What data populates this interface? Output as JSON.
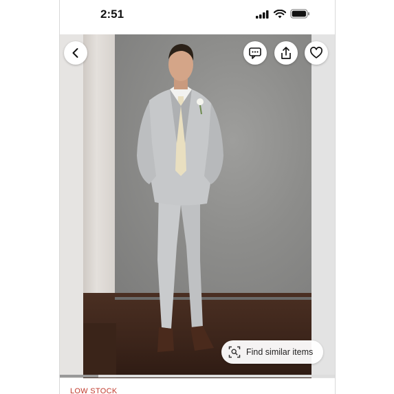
{
  "status_bar": {
    "time": "2:51",
    "icons": [
      "signal-icon",
      "wifi-icon",
      "battery-icon"
    ]
  },
  "photo": {
    "subject": "man-in-light-grey-suit",
    "carousel_position": 0.14
  },
  "overlay_buttons": {
    "back": "chevron-left-icon",
    "message": "message-icon",
    "share": "share-icon",
    "favorite": "heart-icon"
  },
  "find_similar": {
    "icon": "visual-search-icon",
    "label": "Find similar items"
  },
  "stock": {
    "label": "LOW STOCK",
    "color": "#c0392b"
  }
}
